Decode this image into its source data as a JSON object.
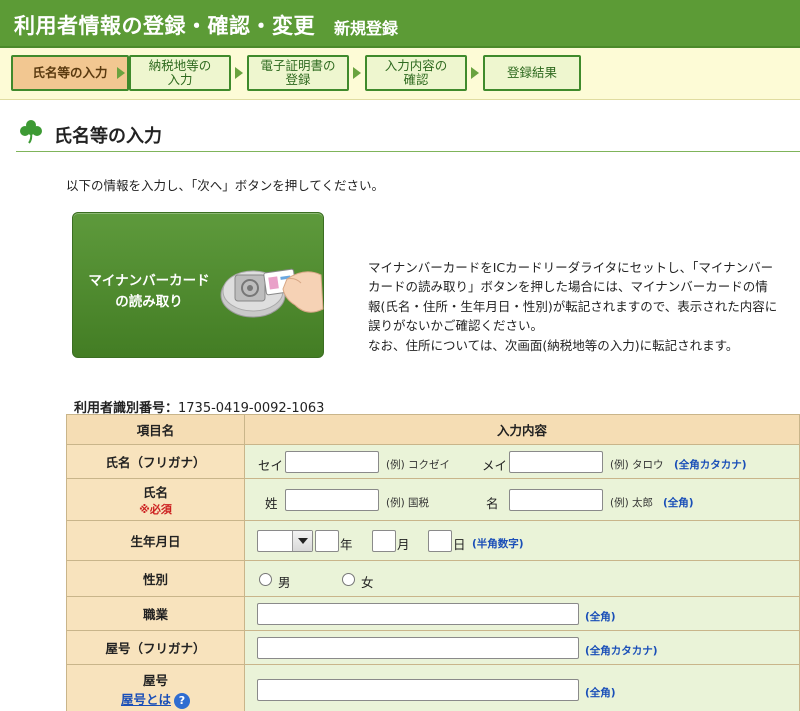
{
  "header": {
    "title": "利用者情報の登録・確認・変更",
    "subtitle": "新規登録"
  },
  "steps": [
    {
      "label": "氏名等の入力",
      "active": true
    },
    {
      "label": "納税地等の\n入力",
      "active": false
    },
    {
      "label": "電子証明書の\n登録",
      "active": false
    },
    {
      "label": "入力内容の\n確認",
      "active": false
    },
    {
      "label": "登録結果",
      "active": false
    }
  ],
  "section": {
    "title": "氏名等の入力"
  },
  "instruction": "以下の情報を入力し、「次へ」ボタンを押してください。",
  "mycard": {
    "button_label_1": "マイナンバーカード",
    "button_label_2": "の読み取り",
    "desc_1": "マイナンバーカードをICカードリーダライタにセットし、「マイナンバーカードの読み取り」ボタンを押した場合には、マイナンバーカードの情報(氏名・住所・生年月日・性別)が転記されますので、表示された内容に誤りがないかご確認ください。",
    "desc_2": "なお、住所については、次画面(納税地等の入力)に転記されます。"
  },
  "user_id": {
    "label": "利用者識別番号：",
    "value": "1735-0419-0092-1063"
  },
  "table": {
    "col_item": "項目名",
    "col_content": "入力内容",
    "kana": {
      "label": "氏名（フリガナ）",
      "sei": "セイ",
      "sei_ex": "(例) コクゼイ",
      "mei": "メイ",
      "mei_ex": "(例) タロウ",
      "note": "(全角カタカナ)"
    },
    "name": {
      "label": "氏名",
      "required": "※必須",
      "sei": "姓",
      "sei_ex": "(例) 国税",
      "mei": "名",
      "mei_ex": "(例) 太郎",
      "note": "(全角)"
    },
    "birth": {
      "label": "生年月日",
      "year": "年",
      "month": "月",
      "day": "日",
      "note": "(半角数字)"
    },
    "gender": {
      "label": "性別",
      "male": "男",
      "female": "女"
    },
    "job": {
      "label": "職業",
      "note": "(全角)"
    },
    "yago_kana": {
      "label": "屋号（フリガナ）",
      "note": "(全角カタカナ)"
    },
    "yago": {
      "label": "屋号",
      "help_link": "屋号とは",
      "help_icon": "?",
      "note": "(全角)"
    }
  }
}
